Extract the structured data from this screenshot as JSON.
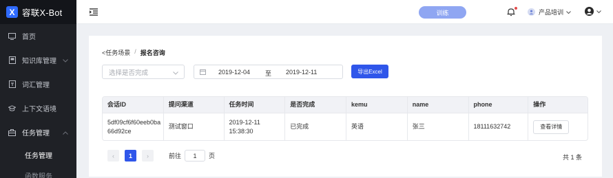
{
  "brand": {
    "logo_letter": "X",
    "name": "容联X-Bot"
  },
  "sidebar": {
    "items": [
      {
        "label": "首页",
        "icon": "monitor-icon"
      },
      {
        "label": "知识库管理",
        "icon": "book-icon"
      },
      {
        "label": "词汇管理",
        "icon": "vocabulary-icon"
      },
      {
        "label": "上下文语境",
        "icon": "graduation-cap-icon"
      },
      {
        "label": "任务管理",
        "icon": "briefcase-icon",
        "expanded": true
      }
    ],
    "sub_items": [
      {
        "label": "任务管理"
      },
      {
        "label": "函数服务"
      }
    ]
  },
  "topbar": {
    "train_label": "训练",
    "workspace_label": "产品培训"
  },
  "breadcrumb": {
    "back": "<任务场景",
    "separator": "/",
    "current": "报名咨询"
  },
  "filters": {
    "status_placeholder": "选择是否完成",
    "date_start": "2019-12-04",
    "date_to": "至",
    "date_end": "2019-12-11",
    "export_label": "导出Excel"
  },
  "table": {
    "headers": [
      "会话ID",
      "提问渠道",
      "任务时间",
      "是否完成",
      "kemu",
      "name",
      "phone",
      "操作"
    ],
    "rows": [
      {
        "session_id": "5df09cf6f60eeb0ba66d92ce",
        "channel": "测试窗口",
        "time": "2019-12-11 15:38:30",
        "completed": "已完成",
        "kemu": "英语",
        "name": "张三",
        "phone": "18111632742",
        "action": "查看详情"
      }
    ]
  },
  "pagination": {
    "prev": "‹",
    "current_page": "1",
    "next": "›",
    "goto_label": "前往",
    "goto_value": "1",
    "page_unit": "页",
    "total": "共 1 条"
  },
  "colors": {
    "sidebar_bg": "#1f2126",
    "primary": "#2f56ea",
    "train_btn": "#8fa6f2",
    "notification_dot": "#e34b4b"
  }
}
